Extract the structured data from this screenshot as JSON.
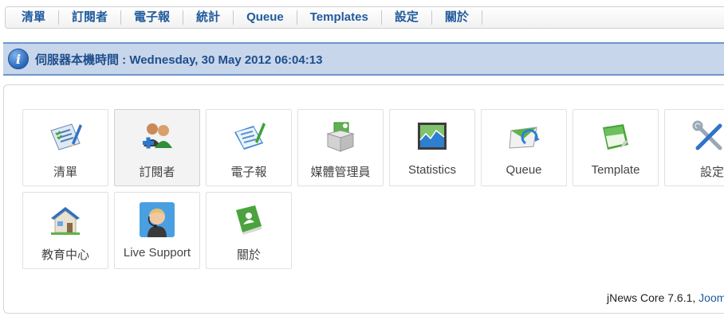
{
  "nav": {
    "items": [
      {
        "label": "清單"
      },
      {
        "label": "訂閱者"
      },
      {
        "label": "電子報"
      },
      {
        "label": "統計"
      },
      {
        "label": "Queue"
      },
      {
        "label": "Templates"
      },
      {
        "label": "設定"
      },
      {
        "label": "關於"
      }
    ]
  },
  "info": {
    "text": "伺服器本機時間 : Wednesday, 30 May 2012 06:04:13",
    "icon": "info-icon"
  },
  "tiles": [
    {
      "label": "清單",
      "icon": "list-icon"
    },
    {
      "label": "訂閱者",
      "icon": "subscribers-icon"
    },
    {
      "label": "電子報",
      "icon": "newsletter-icon"
    },
    {
      "label": "媒體管理員",
      "icon": "media-manager-icon"
    },
    {
      "label": "Statistics",
      "icon": "statistics-icon"
    },
    {
      "label": "Queue",
      "icon": "queue-icon"
    },
    {
      "label": "Template",
      "icon": "template-icon"
    },
    {
      "label": "設定",
      "icon": "settings-tools-icon"
    },
    {
      "label": "教育中心",
      "icon": "house-icon"
    },
    {
      "label": "Live Support",
      "icon": "support-agent-icon"
    },
    {
      "label": "關於",
      "icon": "about-book-icon"
    }
  ],
  "footer": {
    "version": "jNews Core 7.6.1,",
    "link": "Joom"
  },
  "colors": {
    "nav_text": "#1f5a9c",
    "infobar_bg": "#c7d6ea",
    "infobar_border": "#6d96cc"
  }
}
